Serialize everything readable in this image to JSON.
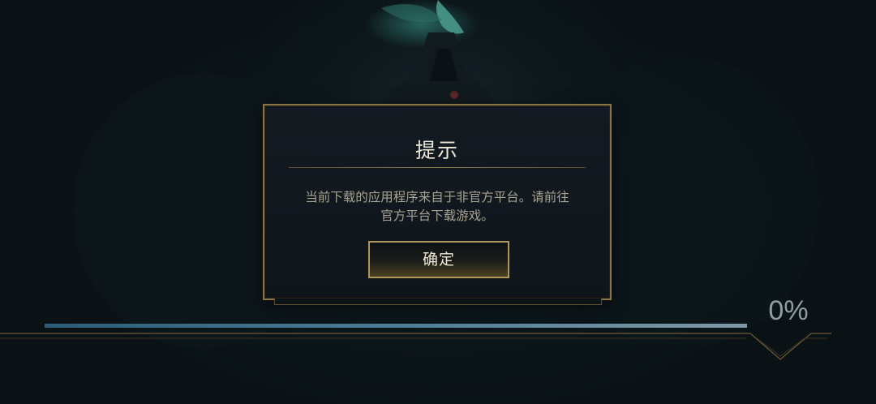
{
  "dialog": {
    "title": "提示",
    "message_line1": "当前下载的应用程序来自于非官方平台。请前往",
    "message_line2": "官方平台下载游戏。",
    "confirm_label": "确定"
  },
  "loading": {
    "progress_fraction": 1.0,
    "percent_text": "0%"
  },
  "colors": {
    "gold_border": "#8a7444",
    "button_border": "#b09656",
    "progress_fill": "#4d7d98",
    "background": "#0a1216"
  }
}
